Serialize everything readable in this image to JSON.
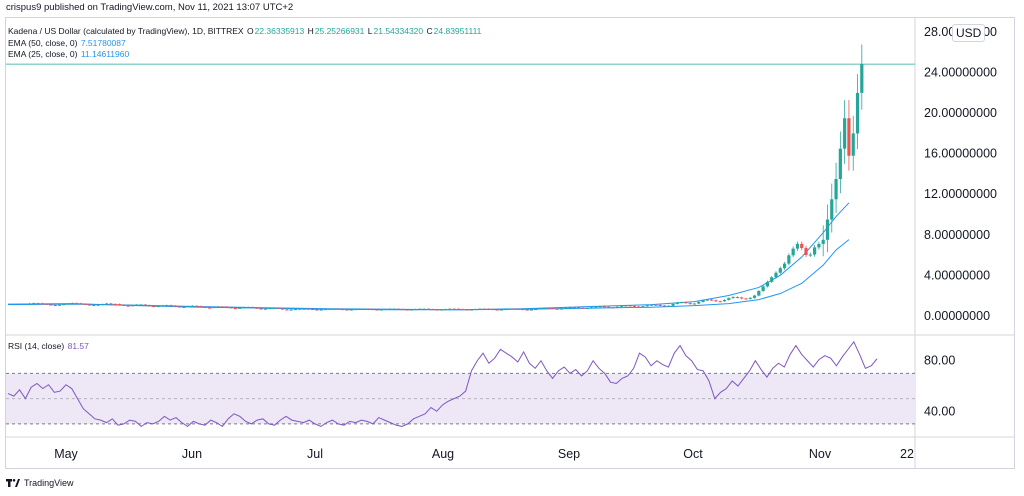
{
  "header": {
    "published": "crispus9 published on TradingView.com, Nov 11, 2021 13:07 UTC+2"
  },
  "legend": {
    "title": "Kadena / US Dollar (calculated by TradingView), 1D, BITTREX",
    "o_label": "O",
    "o_value": "22.36335913",
    "h_label": "H",
    "h_value": "25.25266931",
    "l_label": "L",
    "l_value": "21.54334320",
    "c_label": "C",
    "c_value": "24.83951111",
    "ema50_label": "EMA (50, close, 0)",
    "ema50_value": "7.51780087",
    "ema25_label": "EMA (25, close, 0)",
    "ema25_value": "11.14611960",
    "rsi_label": "RSI (14, close)",
    "rsi_value": "81.57"
  },
  "currency_label": "USD",
  "footer": {
    "brand": "TradingView"
  },
  "colors": {
    "up": "#26a69a",
    "down": "#ef5350",
    "ema": "#2196f3",
    "rsi": "#7e57c2",
    "rsi_band": "#ede7f6"
  },
  "chart_data": [
    {
      "type": "candlestick",
      "title": "Kadena / US Dollar, 1D, BITTREX",
      "ylim": [
        -1.5,
        29
      ],
      "yticks": [
        "28.00000000",
        "24.00000000",
        "20.00000000",
        "16.00000000",
        "12.00000000",
        "8.00000000",
        "4.00000000",
        "0.00000000"
      ],
      "ytick_values": [
        28,
        24,
        20,
        16,
        12,
        8,
        4,
        0
      ],
      "xticks": [
        "May",
        "Jun",
        "Jul",
        "Aug",
        "Sep",
        "Oct",
        "Nov",
        "22"
      ],
      "last_price": 24.84,
      "grid": false,
      "series": [
        {
          "name": "EMA (50, close, 0)",
          "line": [
            [
              0,
              1.1
            ],
            [
              15,
              1.15
            ],
            [
              30,
              1.05
            ],
            [
              45,
              0.9
            ],
            [
              60,
              0.8
            ],
            [
              75,
              0.7
            ],
            [
              90,
              0.65
            ],
            [
              105,
              0.6
            ],
            [
              120,
              0.65
            ],
            [
              135,
              0.75
            ],
            [
              150,
              0.85
            ],
            [
              160,
              1.0
            ],
            [
              168,
              1.2
            ],
            [
              175,
              1.6
            ],
            [
              180,
              2.2
            ],
            [
              185,
              3.2
            ],
            [
              190,
              5.0
            ],
            [
              193,
              6.5
            ],
            [
              196,
              7.52
            ]
          ]
        },
        {
          "name": "EMA (25, close, 0)",
          "line": [
            [
              0,
              1.15
            ],
            [
              15,
              1.2
            ],
            [
              30,
              1.0
            ],
            [
              45,
              0.85
            ],
            [
              60,
              0.75
            ],
            [
              75,
              0.65
            ],
            [
              90,
              0.6
            ],
            [
              105,
              0.6
            ],
            [
              120,
              0.7
            ],
            [
              135,
              0.9
            ],
            [
              150,
              1.1
            ],
            [
              160,
              1.4
            ],
            [
              168,
              2.0
            ],
            [
              175,
              2.8
            ],
            [
              180,
              4.0
            ],
            [
              185,
              5.8
            ],
            [
              190,
              8.2
            ],
            [
              193,
              9.8
            ],
            [
              196,
              11.15
            ]
          ]
        }
      ]
    },
    {
      "type": "line",
      "title": "RSI (14, close)",
      "ylim": [
        22,
        98
      ],
      "yticks": [
        "80.00",
        "40.00"
      ],
      "ytick_values": [
        80,
        40
      ],
      "band": [
        30,
        70
      ],
      "midline": 50,
      "values": [
        54,
        52,
        57,
        50,
        59,
        62,
        58,
        61,
        55,
        56,
        61,
        58,
        50,
        42,
        38,
        34,
        33,
        31,
        34,
        29,
        30,
        33,
        32,
        28,
        31,
        30,
        32,
        36,
        33,
        35,
        31,
        28,
        32,
        30,
        29,
        33,
        31,
        28,
        34,
        38,
        36,
        32,
        30,
        33,
        34,
        30,
        29,
        33,
        36,
        33,
        32,
        31,
        33,
        30,
        28,
        31,
        33,
        30,
        29,
        32,
        31,
        33,
        32,
        30,
        35,
        33,
        31,
        29,
        28,
        30,
        34,
        36,
        38,
        43,
        40,
        45,
        48,
        50,
        52,
        56,
        72,
        80,
        86,
        78,
        82,
        89,
        86,
        83,
        79,
        87,
        78,
        74,
        80,
        72,
        66,
        72,
        75,
        70,
        73,
        68,
        72,
        80,
        74,
        70,
        63,
        62,
        66,
        68,
        74,
        86,
        83,
        76,
        80,
        77,
        75,
        86,
        92,
        84,
        80,
        73,
        72,
        64,
        50,
        55,
        58,
        64,
        60,
        66,
        72,
        80,
        73,
        67,
        74,
        78,
        75,
        85,
        92,
        85,
        80,
        75,
        81,
        84,
        82,
        76,
        83,
        89,
        95,
        85,
        74,
        76,
        81.57
      ]
    }
  ]
}
